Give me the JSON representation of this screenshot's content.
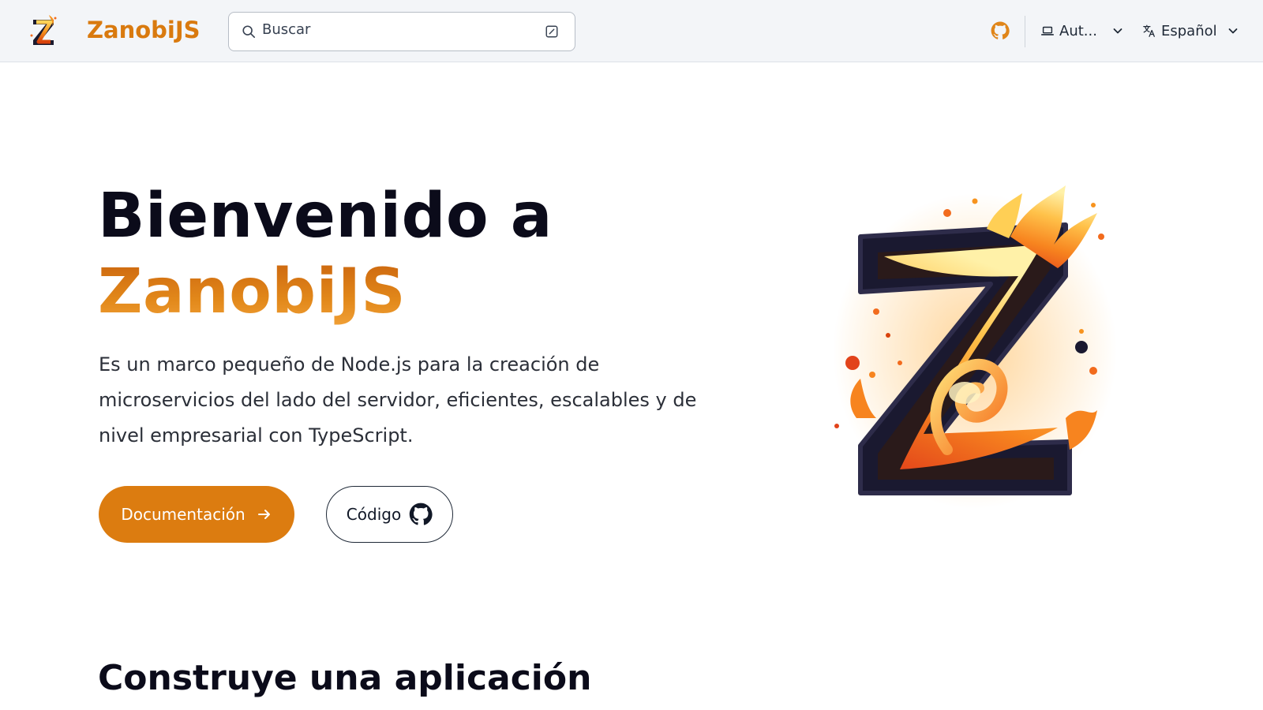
{
  "header": {
    "brand_name": "ZanobiJS",
    "search_placeholder": "Buscar",
    "appearance_label": "Aut...",
    "language_label": "Español"
  },
  "hero": {
    "title_line1": "Bienvenido a",
    "title_line2": "ZanobiJS",
    "description": "Es un marco pequeño de Node.js para la creación de microservicios del lado del servidor, eficientes, escalables y de nivel empresarial con TypeScript.",
    "primary_button": "Documentación",
    "secondary_button": "Código"
  },
  "section": {
    "title": "Construye una aplicación"
  },
  "icons": {
    "search": "search-icon",
    "keyboard": "keyboard-shortcut-icon",
    "github": "github-icon",
    "appearance": "laptop-icon",
    "language": "translate-icon",
    "chevron": "chevron-down-icon",
    "arrow": "arrow-right-icon"
  },
  "colors": {
    "brand": "#dc7c10",
    "title_dark": "#0b0b1a",
    "navbar_bg": "#f3f5f8"
  }
}
